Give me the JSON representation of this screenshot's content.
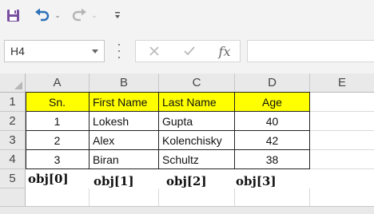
{
  "toolbar": {
    "icons": [
      "save-icon",
      "undo-icon",
      "redo-icon",
      "customize-icon"
    ],
    "undo_dropdown": "⌄",
    "redo_dropdown": "⌄"
  },
  "formula_bar": {
    "name_box": "H4",
    "fx_label": "fx",
    "formula": ""
  },
  "columns": [
    "A",
    "B",
    "C",
    "D",
    "E"
  ],
  "rows": [
    "1",
    "2",
    "3",
    "4",
    "5"
  ],
  "cells": {
    "r1": [
      "Sn.",
      "First Name",
      "Last Name",
      "Age"
    ],
    "r2": [
      "1",
      "Lokesh",
      "Gupta",
      "40"
    ],
    "r3": [
      "2",
      "Alex",
      "Kolenchisky",
      "42"
    ],
    "r4": [
      "3",
      "Biran",
      "Schultz",
      "38"
    ],
    "r5": [
      "obj[0]",
      "obj[1]",
      "obj[2]",
      "obj[3]"
    ]
  },
  "colors": {
    "header_fill": "#ffff00",
    "save_icon": "#7a4fa0",
    "undo_icon": "#2a6fb8"
  }
}
